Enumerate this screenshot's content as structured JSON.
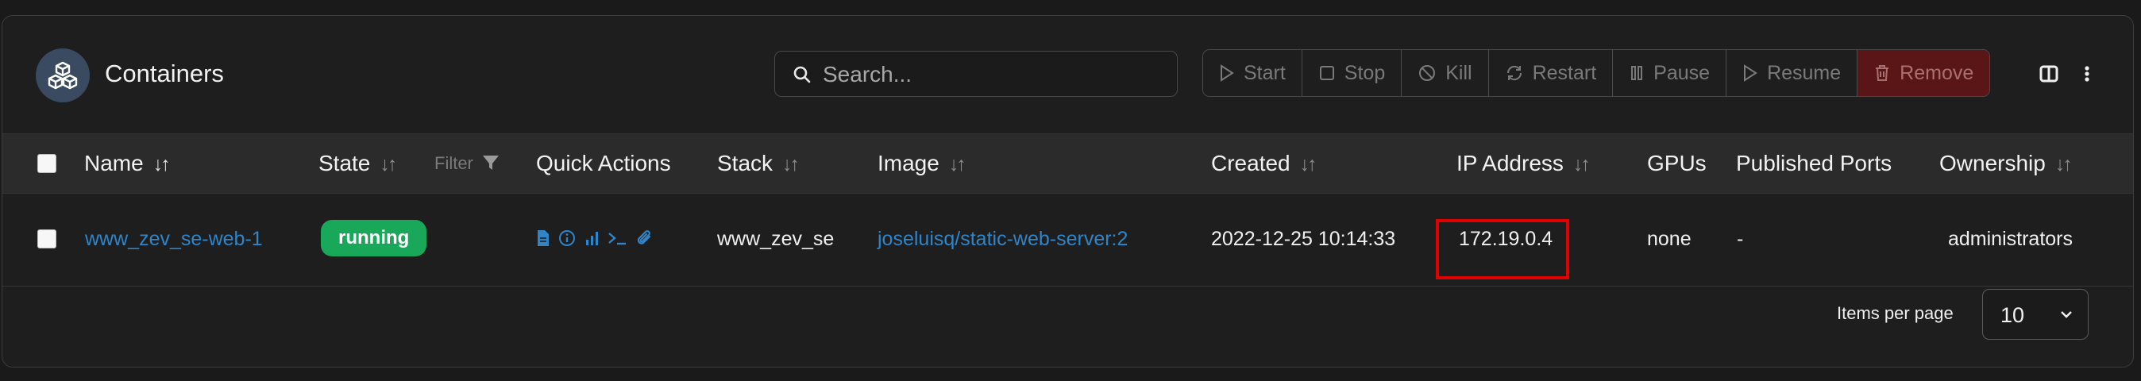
{
  "header": {
    "title": "Containers",
    "icon": "cubes-icon",
    "search_placeholder": "Search...",
    "actions": [
      {
        "label": "Start",
        "icon": "play-icon"
      },
      {
        "label": "Stop",
        "icon": "stop-icon"
      },
      {
        "label": "Kill",
        "icon": "ban-icon"
      },
      {
        "label": "Restart",
        "icon": "refresh-icon"
      },
      {
        "label": "Pause",
        "icon": "pause-icon"
      },
      {
        "label": "Resume",
        "icon": "play-icon"
      },
      {
        "label": "Remove",
        "icon": "trash-icon"
      }
    ],
    "colors": {
      "remove_bg": "#5a1616",
      "accent": "#2f85c8",
      "running": "#19a85a",
      "highlight": "#e00000"
    }
  },
  "table": {
    "columns": {
      "name": "Name",
      "state": "State",
      "filter": "Filter",
      "quick_actions": "Quick Actions",
      "stack": "Stack",
      "image": "Image",
      "created": "Created",
      "ip": "IP Address",
      "gpus": "GPUs",
      "ports": "Published Ports",
      "ownership": "Ownership"
    },
    "rows": [
      {
        "name": "www_zev_se-web-1",
        "state": "running",
        "quick_actions": [
          "logs-icon",
          "info-icon",
          "stats-icon",
          "console-icon",
          "attach-icon"
        ],
        "stack": "www_zev_se",
        "image": "joseluisq/static-web-server:2",
        "created": "2022-12-25 10:14:33",
        "ip": "172.19.0.4",
        "gpus": "none",
        "ports": "-",
        "ownership": "administrators"
      }
    ]
  },
  "footer": {
    "items_per_page_label": "Items per page",
    "items_per_page_value": "10"
  }
}
